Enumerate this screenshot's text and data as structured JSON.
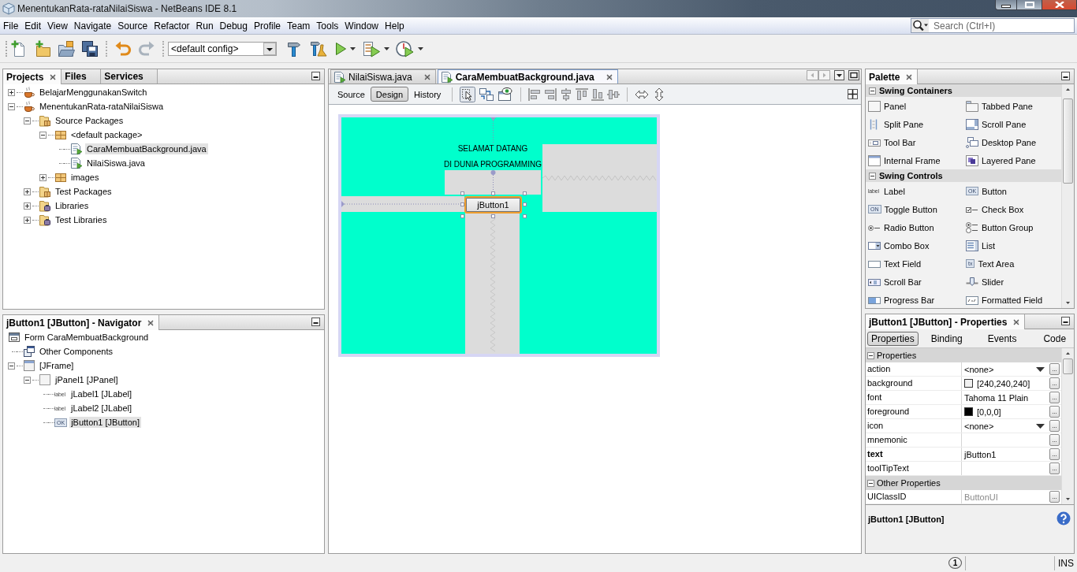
{
  "window": {
    "title": "MenentukanRata-rataNilaiSiswa - NetBeans IDE 8.1"
  },
  "menu_bar": {
    "items": [
      "File",
      "Edit",
      "View",
      "Navigate",
      "Source",
      "Refactor",
      "Run",
      "Debug",
      "Profile",
      "Team",
      "Tools",
      "Window",
      "Help"
    ],
    "search": {
      "placeholder": "Search (Ctrl+I)"
    }
  },
  "toolbar": {
    "config": {
      "value": "<default config>"
    }
  },
  "projects": {
    "tabs": [
      {
        "label": "Projects",
        "selected": true
      },
      {
        "label": "Files",
        "selected": false
      },
      {
        "label": "Services",
        "selected": false
      }
    ],
    "tree": [
      {
        "label": "BelajarMenggunakanSwitch",
        "kind": "project",
        "expanded": false,
        "selected": false
      },
      {
        "label": "MenentukanRata-rataNilaiSiswa",
        "kind": "project",
        "expanded": true,
        "selected": false,
        "children": [
          {
            "label": "Source Packages",
            "kind": "source-folder",
            "expanded": true,
            "selected": false,
            "children": [
              {
                "label": "<default package>",
                "kind": "package",
                "expanded": true,
                "selected": false,
                "children": [
                  {
                    "label": "CaraMembuatBackground.java",
                    "kind": "form-file",
                    "selected": true
                  },
                  {
                    "label": "NilaiSiswa.java",
                    "kind": "form-file",
                    "selected": false
                  }
                ]
              },
              {
                "label": "images",
                "kind": "package",
                "expanded": false,
                "selected": false
              }
            ]
          },
          {
            "label": "Test Packages",
            "kind": "source-folder",
            "expanded": false,
            "selected": false
          },
          {
            "label": "Libraries",
            "kind": "library",
            "expanded": false,
            "selected": false
          },
          {
            "label": "Test Libraries",
            "kind": "library",
            "expanded": false,
            "selected": false
          }
        ]
      }
    ]
  },
  "navigator": {
    "title": "jButton1 [JButton] - Navigator",
    "tree": [
      {
        "label": "Form CaraMembuatBackground",
        "kind": "form",
        "selected": false,
        "children": [
          {
            "label": "Other Components",
            "kind": "other-components",
            "selected": false
          },
          {
            "label": "[JFrame]",
            "kind": "frame",
            "expanded": true,
            "selected": false,
            "children": [
              {
                "label": "jPanel1 [JPanel]",
                "kind": "panel",
                "expanded": true,
                "selected": false,
                "children": [
                  {
                    "label": "jLabel1 [JLabel]",
                    "kind": "label",
                    "icon_text": "label",
                    "selected": false
                  },
                  {
                    "label": "jLabel2 [JLabel]",
                    "kind": "label",
                    "icon_text": "label",
                    "selected": false
                  },
                  {
                    "label": "jButton1 [JButton]",
                    "kind": "button",
                    "icon_text": "OK",
                    "selected": true
                  }
                ]
              }
            ]
          }
        ]
      }
    ]
  },
  "editor": {
    "tabs": [
      {
        "label": "NilaiSiswa.java",
        "selected": false
      },
      {
        "label": "CaraMembuatBackground.java",
        "selected": true
      }
    ],
    "views": [
      {
        "label": "Source",
        "selected": false
      },
      {
        "label": "Design",
        "selected": true
      },
      {
        "label": "History",
        "selected": false
      }
    ],
    "form": {
      "labels": [
        "SELAMAT DATANG",
        "DI DUNIA PROGRAMMING"
      ],
      "button": {
        "label": "jButton1",
        "selected": true
      }
    }
  },
  "palette": {
    "title": "Palette",
    "categories": [
      {
        "name": "Swing Containers",
        "expanded": true,
        "items": [
          {
            "label": "Panel"
          },
          {
            "label": "Tabbed Pane"
          },
          {
            "label": "Split Pane"
          },
          {
            "label": "Scroll Pane"
          },
          {
            "label": "Tool Bar"
          },
          {
            "label": "Desktop Pane"
          },
          {
            "label": "Internal Frame"
          },
          {
            "label": "Layered Pane"
          }
        ]
      },
      {
        "name": "Swing Controls",
        "expanded": true,
        "items": [
          {
            "label": "Label",
            "icon_text": "label"
          },
          {
            "label": "Button",
            "icon_text": "OK"
          },
          {
            "label": "Toggle Button",
            "icon_text": "ON"
          },
          {
            "label": "Check Box"
          },
          {
            "label": "Radio Button"
          },
          {
            "label": "Button Group"
          },
          {
            "label": "Combo Box"
          },
          {
            "label": "List"
          },
          {
            "label": "Text Field"
          },
          {
            "label": "Text Area",
            "icon_text": "tx"
          },
          {
            "label": "Scroll Bar"
          },
          {
            "label": "Slider"
          },
          {
            "label": "Progress Bar"
          },
          {
            "label": "Formatted Field"
          }
        ]
      }
    ]
  },
  "properties": {
    "title": "jButton1 [JButton] - Properties",
    "tabs": [
      {
        "label": "Properties",
        "selected": true
      },
      {
        "label": "Binding",
        "selected": false
      },
      {
        "label": "Events",
        "selected": false
      },
      {
        "label": "Code",
        "selected": false
      }
    ],
    "sections": [
      {
        "name": "Properties",
        "expanded": true,
        "rows": [
          {
            "name": "action",
            "kind": "combo",
            "value": "<none>",
            "modified": false,
            "disabled": false,
            "button": "..."
          },
          {
            "name": "background",
            "kind": "color",
            "color": "#f0f0f0",
            "value": "[240,240,240]",
            "modified": false,
            "disabled": false,
            "button": "..."
          },
          {
            "name": "font",
            "kind": "text",
            "value": "Tahoma 11 Plain",
            "modified": false,
            "disabled": false,
            "button": "..."
          },
          {
            "name": "foreground",
            "kind": "color",
            "color": "#000000",
            "value": "[0,0,0]",
            "modified": false,
            "disabled": false,
            "button": "..."
          },
          {
            "name": "icon",
            "kind": "combo",
            "value": "<none>",
            "modified": false,
            "disabled": false,
            "button": "..."
          },
          {
            "name": "mnemonic",
            "kind": "text",
            "modified": false,
            "disabled": false,
            "button": "..."
          },
          {
            "name": "text",
            "kind": "text",
            "value": "jButton1",
            "modified": true,
            "disabled": false,
            "button": "..."
          },
          {
            "name": "toolTipText",
            "kind": "text",
            "modified": false,
            "disabled": false,
            "button": "..."
          }
        ]
      },
      {
        "name": "Other Properties",
        "expanded": true,
        "rows": [
          {
            "name": "UIClassID",
            "kind": "text",
            "value": "ButtonUI",
            "modified": false,
            "disabled": true,
            "button": "..."
          }
        ]
      }
    ],
    "description": {
      "title": "jButton1 [JButton]"
    }
  },
  "status_bar": {
    "notifications": "1",
    "insert_mode": "INS"
  }
}
